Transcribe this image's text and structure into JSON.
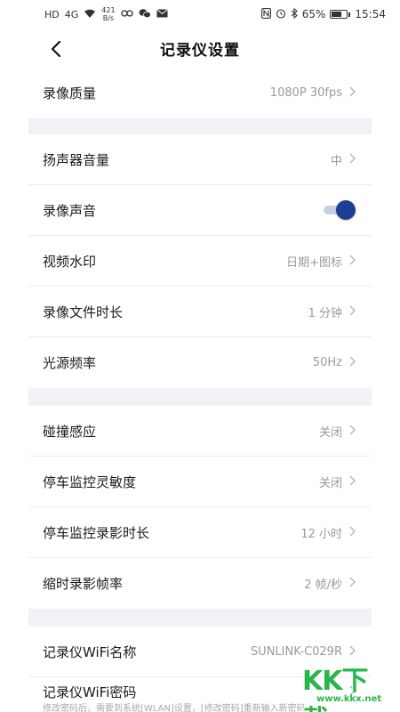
{
  "status_bar": {
    "left_icons": [
      "HD",
      "4G"
    ],
    "speed_value": "421",
    "speed_unit": "B/s",
    "battery": "65%",
    "time": "15:54"
  },
  "nav": {
    "title": "记录仪设置"
  },
  "groups": [
    {
      "rows": [
        {
          "label": "录像质量",
          "value": "1080P 30fps"
        }
      ]
    },
    {
      "rows": [
        {
          "label": "扬声器音量",
          "value": "中"
        },
        {
          "label": "录像声音",
          "toggle_on": true
        },
        {
          "label": "视频水印",
          "value": "日期+图标"
        },
        {
          "label": "录像文件时长",
          "value": "1 分钟"
        },
        {
          "label": "光源频率",
          "value": "50Hz"
        }
      ]
    },
    {
      "rows": [
        {
          "label": "碰撞感应",
          "value": "关闭"
        },
        {
          "label": "停车监控灵敏度",
          "value": "关闭"
        },
        {
          "label": "停车监控录影时长",
          "value": "12 小时"
        },
        {
          "label": "缩时录影帧率",
          "value": "2 帧/秒"
        }
      ]
    },
    {
      "rows": [
        {
          "label": "记录仪WiFi名称",
          "value": "SUNLINK-C029R"
        },
        {
          "label": "记录仪WiFi密码",
          "hint": "修改密码后，需要到系统[WLAN]设置，[修改密码]重新输入新密码"
        }
      ]
    }
  ],
  "watermark": {
    "logo": "KK下载",
    "site": "www.kkx.net"
  },
  "colors": {
    "accent": "#1e3f94",
    "section_gap": "#f0f2f7",
    "value_text": "#9a9a9a"
  }
}
